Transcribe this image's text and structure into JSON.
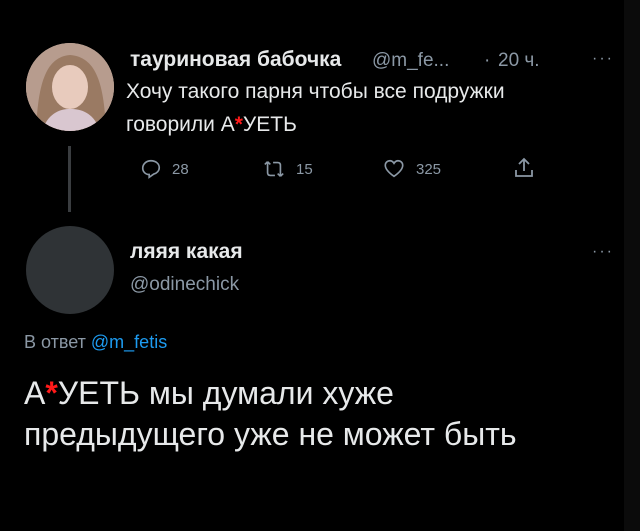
{
  "tweet1": {
    "display_name": "тауриновая бабочка",
    "handle": "@m_fe...",
    "separator": "·",
    "time": "20 ч.",
    "more": "···",
    "text_line1": "Хочу такого парня чтобы все подружки",
    "text_line2_a": "говорили А",
    "text_line2_censor": "*",
    "text_line2_b": "УЕТЬ",
    "replies": "28",
    "retweets": "15",
    "likes": "325"
  },
  "tweet2": {
    "display_name": "ляяя какая",
    "handle": "@odinechick",
    "more": "···",
    "reply_prefix": "В ответ",
    "reply_handle": "@m_fetis",
    "text_a": "А",
    "text_censor": "*",
    "text_b": "УЕТЬ мы думали хуже",
    "text_line2": "предыдущего уже не может быть"
  }
}
